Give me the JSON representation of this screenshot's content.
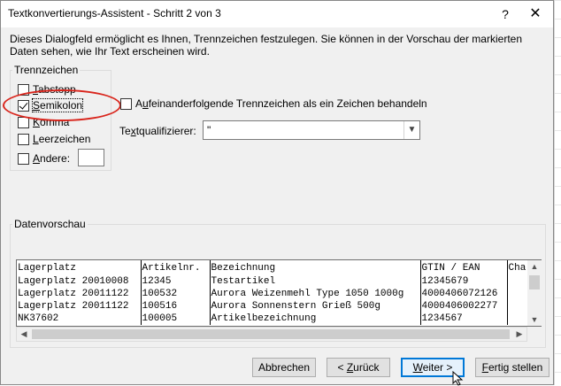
{
  "window": {
    "title": "Textkonvertierungs-Assistent - Schritt 2 von 3",
    "help_glyph": "?",
    "close_glyph": "✕"
  },
  "intro_text": "Dieses Dialogfeld ermöglicht es Ihnen, Trennzeichen festzulegen. Sie können in der Vorschau der markierten Daten sehen, wie Ihr Text erscheinen wird.",
  "delimiters": {
    "group_label": "Trennzeichen",
    "items": [
      {
        "label": "Tabstopp",
        "checked": false
      },
      {
        "label": "Semikolon",
        "checked": true
      },
      {
        "label": "Komma",
        "checked": false
      },
      {
        "label": "Leerzeichen",
        "checked": false
      },
      {
        "label": "Andere:",
        "checked": false
      }
    ],
    "other_value": ""
  },
  "consecutive": {
    "label": "Aufeinanderfolgende Trennzeichen als ein Zeichen behandeln",
    "checked": false
  },
  "text_qualifier": {
    "label": "Textqualifizierer:",
    "value": "\""
  },
  "preview": {
    "group_label": "Datenvorschau",
    "rows": [
      [
        "Lagerplatz",
        "Artikelnr.",
        "Bezeichnung",
        "GTIN / EAN",
        "Cha"
      ],
      [
        "Lagerplatz 20010008",
        "12345",
        "Testartikel",
        "12345679",
        ""
      ],
      [
        "Lagerplatz 20011122",
        "100532",
        "Aurora Weizenmehl Type 1050 1000g",
        "4000406072126",
        ""
      ],
      [
        "Lagerplatz 20011122",
        "100516",
        "Aurora Sonnenstern Grieß 500g",
        "4000406002277",
        ""
      ],
      [
        "NK37602",
        "100005",
        "Artikelbezeichnung",
        "1234567",
        ""
      ]
    ]
  },
  "buttons": {
    "cancel": "Abbrechen",
    "back": "< Zurück",
    "next": "Weiter >",
    "finish": "Fertig stellen"
  },
  "colors": {
    "highlight": "#d9251c",
    "default_button_border": "#0078d7"
  }
}
